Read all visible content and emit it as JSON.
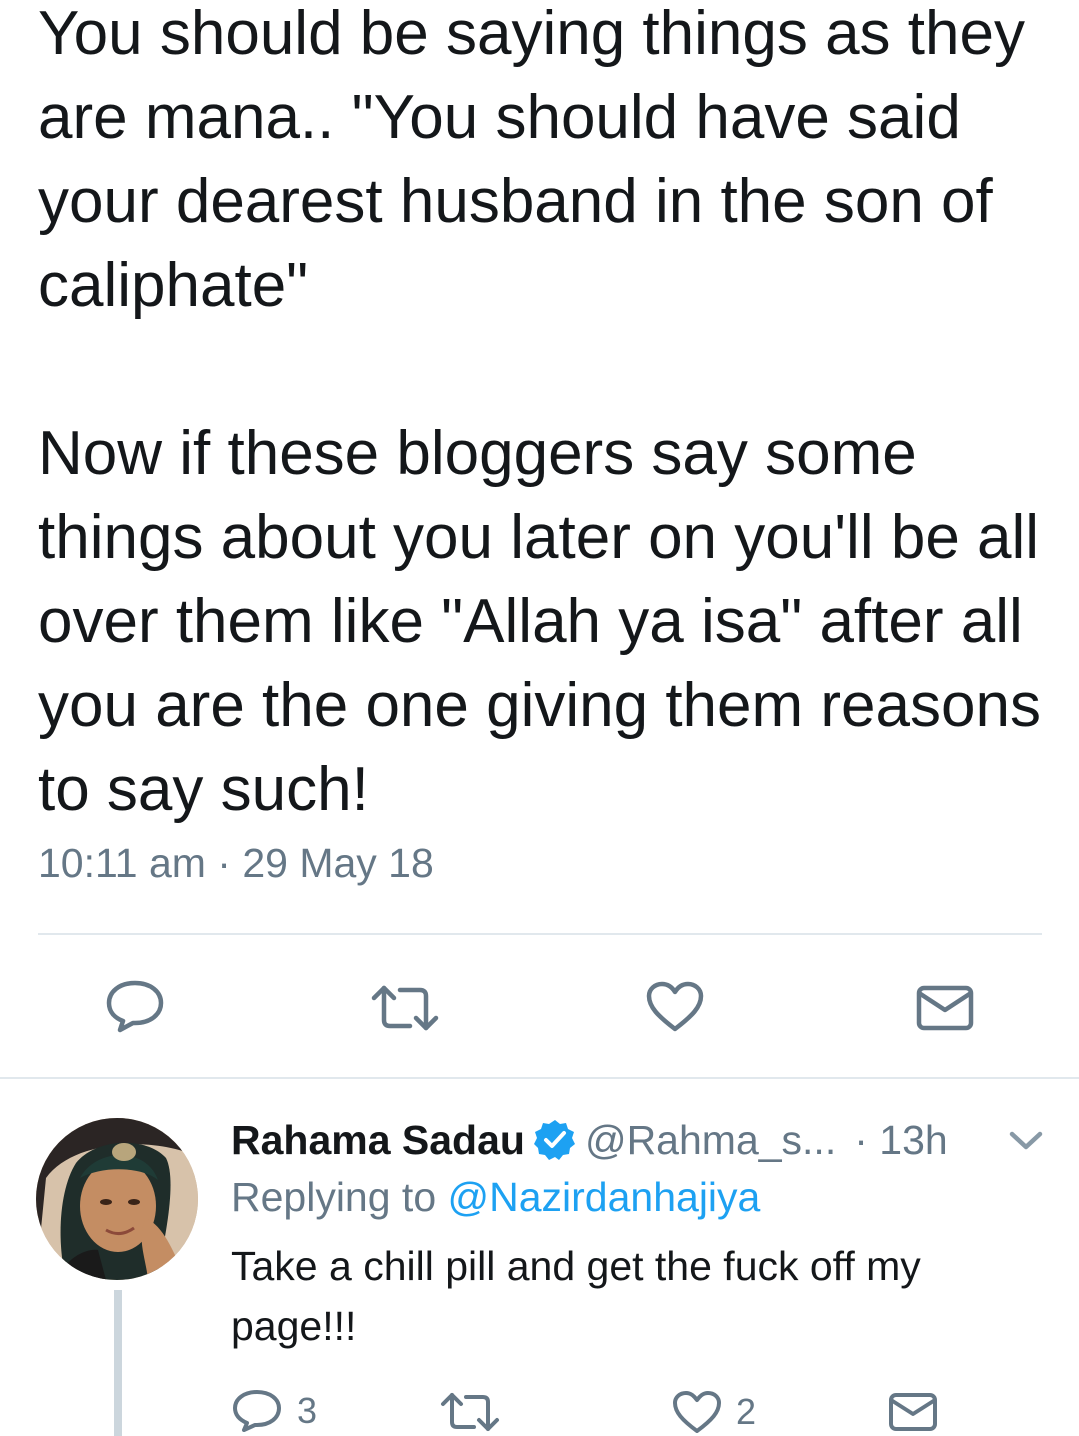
{
  "tweet": {
    "paragraph_1": "You should be saying things as they are mana.. \"You should have said your dearest husband in the son of caliphate\"",
    "paragraph_2": "Now if these bloggers say some things about you  later on you'll be all over them like \"Allah ya isa\" after all you are the one giving them reasons to say such!",
    "time": "10:11 am",
    "separator": " · ",
    "date": "29 May 18"
  },
  "actions": {
    "reply_icon": "reply-icon",
    "retweet_icon": "retweet-icon",
    "like_icon": "heart-icon",
    "dm_icon": "envelope-icon"
  },
  "reply": {
    "name": "Rahama Sadau",
    "handle": "@Rahma_s...",
    "time": "· 13h",
    "replying_prefix": "Replying to ",
    "replying_to": "@Nazirdanhajiya",
    "text": "Take a chill pill and get the fuck off my page!!!",
    "reply_count": "3",
    "retweet_count": "",
    "like_count": "2"
  },
  "colors": {
    "text": "#14171a",
    "muted": "#657786",
    "accent": "#1da1f2",
    "divider": "#e1e8ed"
  }
}
